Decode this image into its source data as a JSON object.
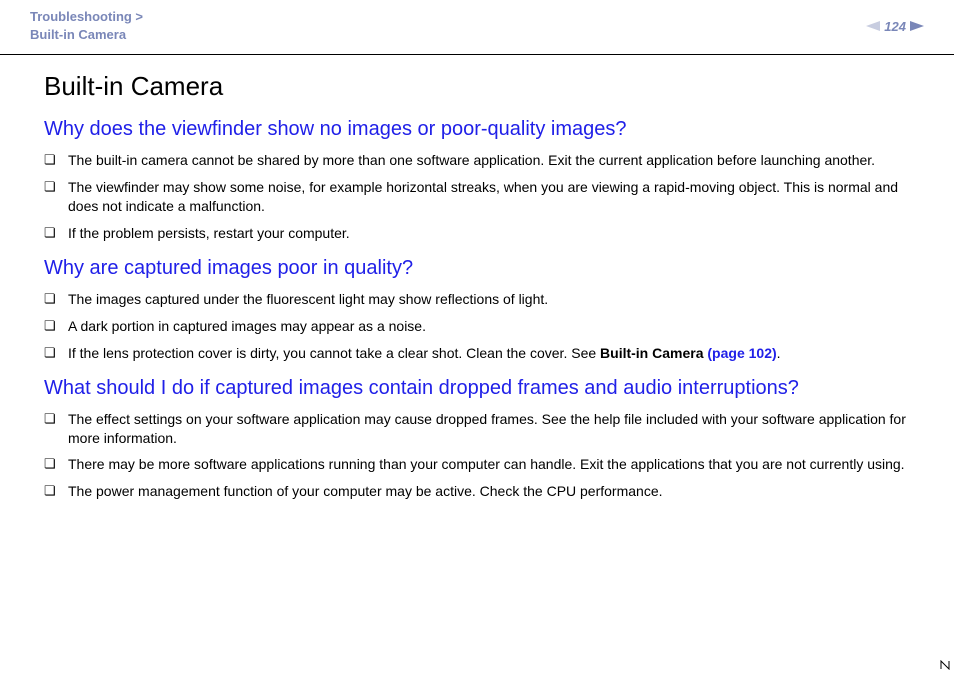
{
  "header": {
    "breadcrumb_line1": "Troubleshooting >",
    "breadcrumb_line2": "Built-in Camera",
    "page_number": "124"
  },
  "main": {
    "title": "Built-in Camera",
    "sections": [
      {
        "heading": "Why does the viewfinder show no images or poor-quality images?",
        "items": [
          "The built-in camera cannot be shared by more than one software application. Exit the current application before launching another.",
          "The viewfinder may show some noise, for example horizontal streaks, when you are viewing a rapid-moving object. This is normal and does not indicate a malfunction.",
          "If the problem persists, restart your computer."
        ]
      },
      {
        "heading": "Why are captured images poor in quality?",
        "items": [
          "The images captured under the fluorescent light may show reflections of light.",
          "A dark portion in captured images may appear as a noise."
        ],
        "item_with_link": {
          "prefix": "If the lens protection cover is dirty, you cannot take a clear shot. Clean the cover. See ",
          "bold_text": "Built-in Camera ",
          "link_text": "(page 102)",
          "suffix": "."
        }
      },
      {
        "heading": "What should I do if captured images contain dropped frames and audio interruptions?",
        "items": [
          "The effect settings on your software application may cause dropped frames. See the help file included with your software application for more information.",
          "There may be more software applications running than your computer can handle. Exit the applications that you are not currently using.",
          "The power management function of your computer may be active. Check the CPU performance."
        ]
      }
    ]
  }
}
